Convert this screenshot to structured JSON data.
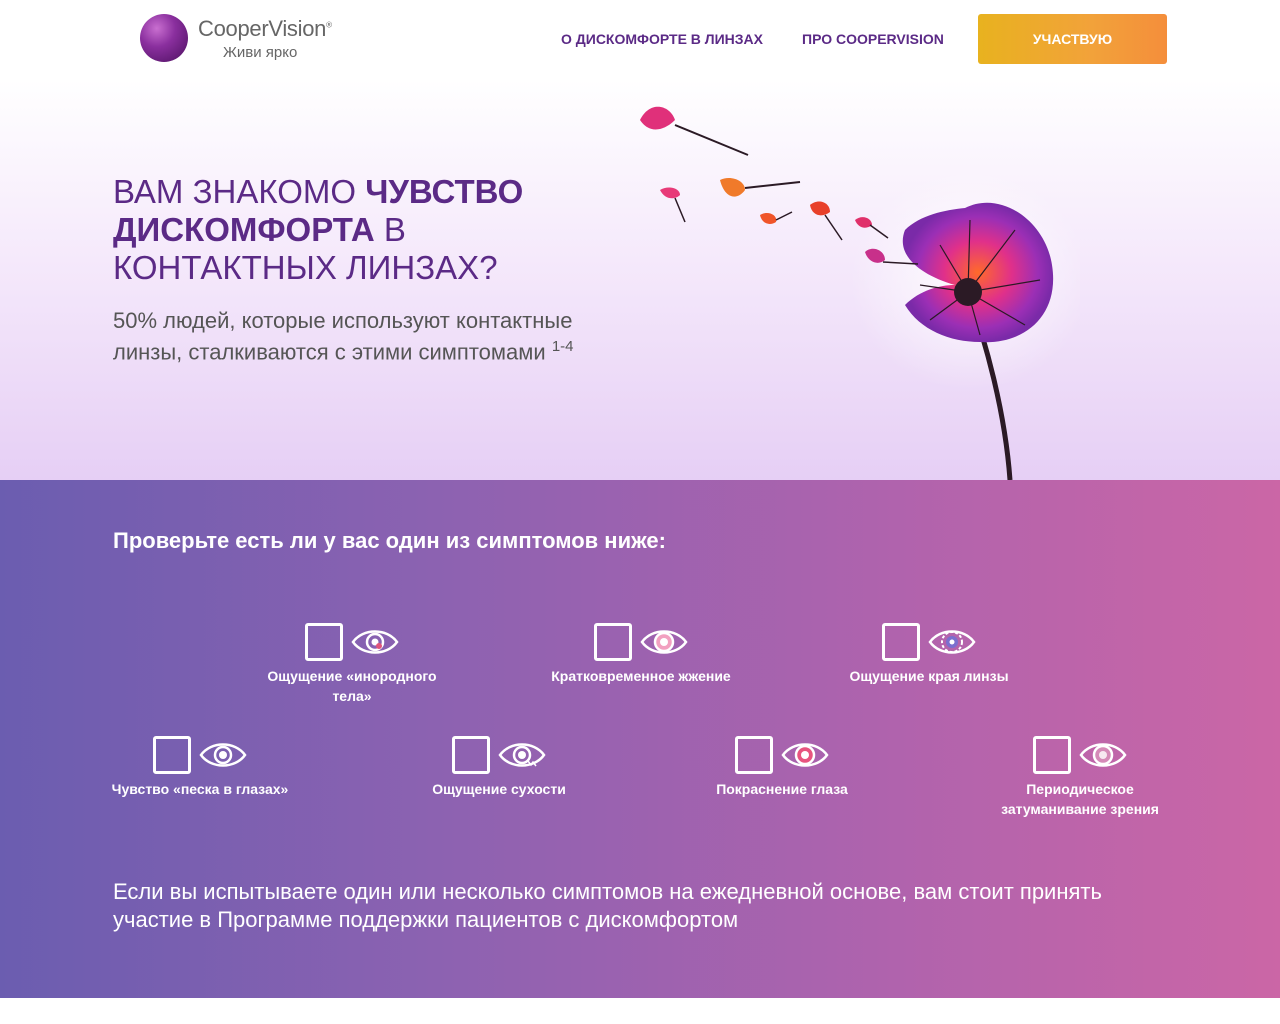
{
  "header": {
    "logo_name": "CooperVision",
    "logo_reg": "®",
    "logo_tagline": "Живи ярко",
    "nav": [
      "О ДИСКОМФОРТЕ В ЛИНЗАХ",
      "ПРО COOPERVISION"
    ],
    "cta_label": "УЧАСТВУЮ"
  },
  "hero": {
    "title_part1": "ВАМ ЗНАКОМО ",
    "title_bold": "ЧУВСТВО ДИСКОМФОРТА",
    "title_part2": " В КОНТАКТНЫХ ЛИНЗАХ?",
    "subtitle": "50% людей, которые используют контактные линзы, сталкиваются с этими симптомами",
    "subtitle_ref": "1-4"
  },
  "symptoms": {
    "heading": "Проверьте есть ли у вас один из симптомов ниже:",
    "items": [
      {
        "label": "Ощущение «инородного тела»",
        "icon": "eye-foreign-body-icon",
        "accent": "#e0557a"
      },
      {
        "label": "Кратковременное жжение",
        "icon": "eye-burning-icon",
        "accent": "#f2a0c0"
      },
      {
        "label": "Ощущение края линзы",
        "icon": "eye-lens-edge-icon",
        "accent": "#7b6fcf"
      },
      {
        "label": "Чувство «песка в глазах»",
        "icon": "eye-sand-icon",
        "accent": "#ffffff"
      },
      {
        "label": "Ощущение сухости",
        "icon": "eye-dryness-icon",
        "accent": "#ffffff"
      },
      {
        "label": "Покраснение глаза",
        "icon": "eye-redness-icon",
        "accent": "#e8557f"
      },
      {
        "label": "Периодическое затуманивание зрения",
        "icon": "eye-blurred-icon",
        "accent": "#d58ab8"
      }
    ],
    "footer": "Если вы испытываете один или несколько симптомов на ежедневной основе, вам стоит принять участие в Программе поддержки пациентов с дискомфортом"
  },
  "colors": {
    "brand_purple": "#5b2a86",
    "cta_orange": "#f2a23a",
    "gradient_start": "#6b5db0",
    "gradient_end": "#cb66a6"
  }
}
